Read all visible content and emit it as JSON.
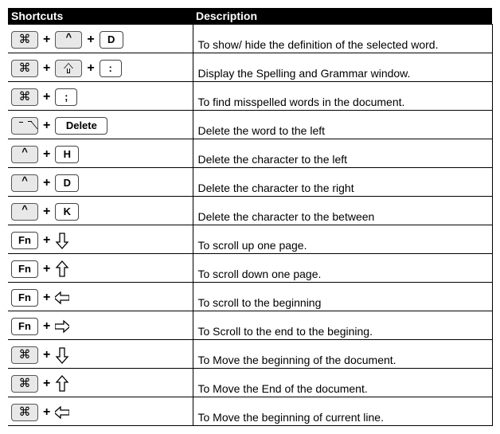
{
  "headers": {
    "shortcuts": "Shortcuts",
    "description": "Description"
  },
  "keys": {
    "cmd": "⌘",
    "ctrl": "^",
    "fn": "Fn",
    "delete": "Delete",
    "D": "D",
    "H": "H",
    "K": "K",
    "colon": ":",
    "semicolon": ";"
  },
  "rows": [
    {
      "keys": [
        "cmd",
        "ctrlGray",
        "D"
      ],
      "desc": "To show/ hide the definition of the selected word."
    },
    {
      "keys": [
        "cmd",
        "shift",
        "colon"
      ],
      "desc": "Display the Spelling and Grammar window."
    },
    {
      "keys": [
        "cmd",
        "semicolon"
      ],
      "desc": "To find misspelled words in the document."
    },
    {
      "keys": [
        "optGray",
        "delete"
      ],
      "desc": "Delete the word to the left"
    },
    {
      "keys": [
        "ctrlGray",
        "H"
      ],
      "desc": "Delete the character to the left"
    },
    {
      "keys": [
        "ctrlGray",
        "D"
      ],
      "desc": "Delete the character to the right"
    },
    {
      "keys": [
        "ctrlGray",
        "K"
      ],
      "desc": "Delete the character to the between"
    },
    {
      "keys": [
        "fn",
        "arrowDown"
      ],
      "desc": "To scroll up one page."
    },
    {
      "keys": [
        "fn",
        "arrowUp"
      ],
      "desc": "To scroll down one page."
    },
    {
      "keys": [
        "fn",
        "arrowLeft"
      ],
      "desc": "To scroll to the beginning"
    },
    {
      "keys": [
        "fn",
        "arrowRight"
      ],
      "desc": "To Scroll to the end to the begining."
    },
    {
      "keys": [
        "cmd",
        "arrowDown"
      ],
      "desc": "To Move the beginning of the document."
    },
    {
      "keys": [
        "cmd",
        "arrowUp"
      ],
      "desc": "To Move the End of the document."
    },
    {
      "keys": [
        "cmd",
        "arrowLeft"
      ],
      "desc": "To Move the beginning of current line."
    }
  ]
}
